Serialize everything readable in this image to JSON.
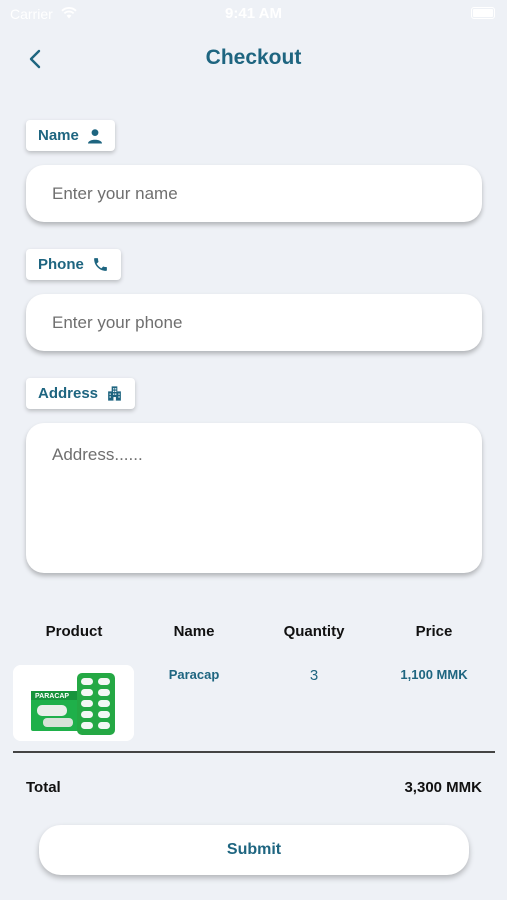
{
  "status_bar": {
    "carrier": "Carrier",
    "time": "9:41 AM"
  },
  "header": {
    "title": "Checkout"
  },
  "form": {
    "name_label": "Name",
    "name_placeholder": "Enter your name",
    "phone_label": "Phone",
    "phone_placeholder": "Enter your phone",
    "address_label": "Address",
    "address_placeholder": "Address......"
  },
  "table": {
    "headers": [
      "Product",
      "Name",
      "Quantity",
      "Price"
    ],
    "rows": [
      {
        "image_brand": "PARACAP",
        "name": "Paracap",
        "quantity": "3",
        "price": "1,100 MMK"
      }
    ]
  },
  "summary": {
    "total_label": "Total",
    "total_value": "3,300 MMK"
  },
  "actions": {
    "submit_label": "Submit"
  },
  "colors": {
    "accent": "#1e6580",
    "background": "#eef1f6",
    "product_green": "#1fb04a"
  },
  "icons": [
    "back-chevron-icon",
    "person-icon",
    "phone-icon",
    "building-icon",
    "wifi-icon",
    "battery-icon"
  ]
}
